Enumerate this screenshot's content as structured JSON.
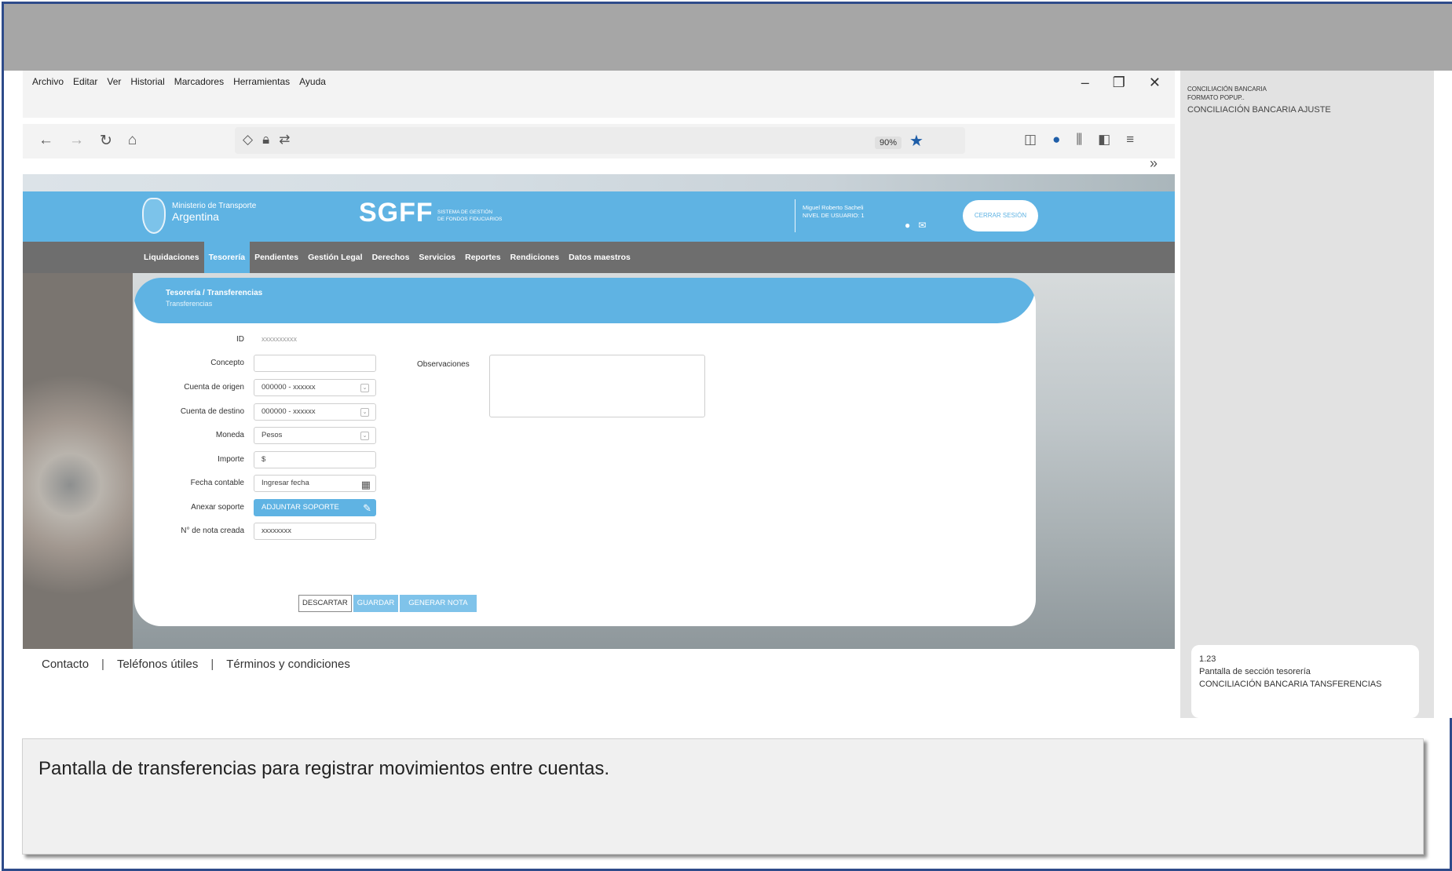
{
  "browser": {
    "menu": [
      "Archivo",
      "Editar",
      "Ver",
      "Historial",
      "Marcadores",
      "Herramientas",
      "Ayuda"
    ],
    "zoom": "90%",
    "window_controls": {
      "minimize": "–",
      "restore": "❐",
      "close": "✕"
    }
  },
  "site": {
    "ministry_line1": "Ministerio de Transporte",
    "ministry_line2": "Argentina",
    "app_name": "SGFF",
    "app_subtitle_1": "Sistema de gestión",
    "app_subtitle_2": "de fondos fiduciarios",
    "user_name": "Miguel Roberto Sacheli",
    "user_level": "NIVEL DE USUARIO: 1",
    "logout": "Cerrar sesión",
    "nav": [
      "Liquidaciones",
      "Tesorería",
      "Pendientes",
      "Gestión Legal",
      "Derechos",
      "Servicios",
      "Reportes",
      "Rendiciones",
      "Datos maestros"
    ],
    "active_nav": "Tesorería"
  },
  "card": {
    "breadcrumb": "Tesorería / Transferencias",
    "subtitle": "Transferencias"
  },
  "form": {
    "id_label": "ID",
    "id_value": "xxxxxxxxxx",
    "concepto_label": "Concepto",
    "concepto_value": "",
    "origen_label": "Cuenta de origen",
    "origen_value": "000000 - xxxxxx",
    "destino_label": "Cuenta de destino",
    "destino_value": "000000 - xxxxxx",
    "moneda_label": "Moneda",
    "moneda_value": "Pesos",
    "importe_label": "Importe",
    "importe_value": "$",
    "fecha_label": "Fecha contable",
    "fecha_placeholder": "Ingresar fecha",
    "anexar_label": "Anexar soporte",
    "anexar_button": "Adjuntar soporte",
    "nota_label": "N° de nota creada",
    "nota_value": "xxxxxxxx",
    "observaciones_label": "Observaciones",
    "observaciones_value": ""
  },
  "actions": {
    "discard": "DESCARTAR",
    "save": "GUARDAR",
    "generate": "GENERAR NOTA"
  },
  "footer": {
    "contact": "Contacto",
    "phones": "Teléfonos útiles",
    "terms": "Términos y condiciones"
  },
  "side_panel": {
    "top_line1": "CONCILIACIÓN BANCARIA",
    "top_line2": "FORMATO POPUP..",
    "title": "CONCILIACIÓN BANCARIA AJUSTE",
    "card_number": "1.23",
    "card_line2": "Pantalla de sección tesorería",
    "card_line3": "CONCILIACIÓN BANCARIA TANSFERENCIAS"
  },
  "caption": "Pantalla de transferencias para registrar movimientos entre cuentas.",
  "colors": {
    "accent_blue": "#5fb3e3",
    "nav_grey": "#6e6e6e",
    "frame_blue": "#2e4b8a"
  }
}
